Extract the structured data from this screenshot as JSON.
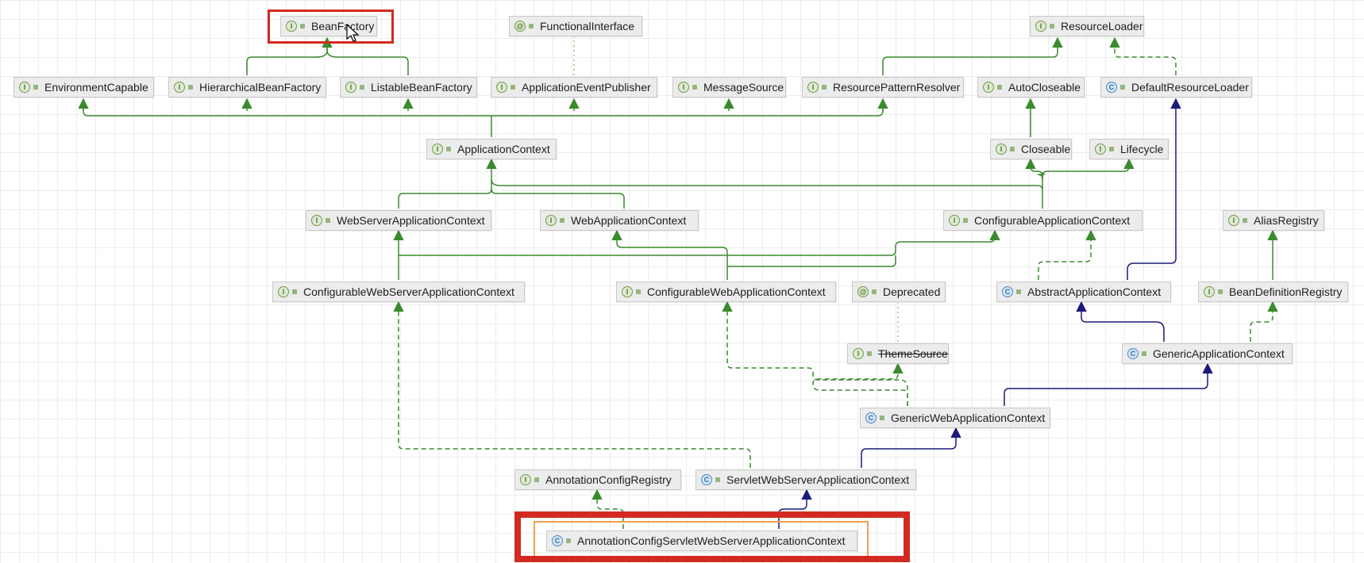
{
  "nodes": {
    "bean_factory": "BeanFactory",
    "functional_interface": "FunctionalInterface",
    "resource_loader": "ResourceLoader",
    "environment_capable": "EnvironmentCapable",
    "hierarchical_bean_factory": "HierarchicalBeanFactory",
    "listable_bean_factory": "ListableBeanFactory",
    "application_event_publisher": "ApplicationEventPublisher",
    "message_source": "MessageSource",
    "resource_pattern_resolver": "ResourcePatternResolver",
    "auto_closeable": "AutoCloseable",
    "default_resource_loader": "DefaultResourceLoader",
    "application_context": "ApplicationContext",
    "closeable": "Closeable",
    "lifecycle": "Lifecycle",
    "web_server_application_context": "WebServerApplicationContext",
    "web_application_context": "WebApplicationContext",
    "configurable_application_context": "ConfigurableApplicationContext",
    "alias_registry": "AliasRegistry",
    "configurable_web_server_application_context": "ConfigurableWebServerApplicationContext",
    "configurable_web_application_context": "ConfigurableWebApplicationContext",
    "deprecated": "Deprecated",
    "abstract_application_context": "AbstractApplicationContext",
    "bean_definition_registry": "BeanDefinitionRegistry",
    "theme_source": "ThemeSource",
    "generic_application_context": "GenericApplicationContext",
    "generic_web_application_context": "GenericWebApplicationContext",
    "annotation_config_registry": "AnnotationConfigRegistry",
    "servlet_web_server_application_context": "ServletWebServerApplicationContext",
    "annotation_config_servlet_web_server_application_context": "AnnotationConfigServletWebServerApplicationContext"
  },
  "kind_glyphs": {
    "interface": "I",
    "class": "C",
    "annotation": "@"
  },
  "colors": {
    "extends_interface": "#3c8a2e",
    "extends_class": "#1a1a7a",
    "implements": "#3c8a2e",
    "annotation_link": "#9cc27c",
    "highlight_red": "#d22a20",
    "highlight_orange": "#f0a050"
  }
}
